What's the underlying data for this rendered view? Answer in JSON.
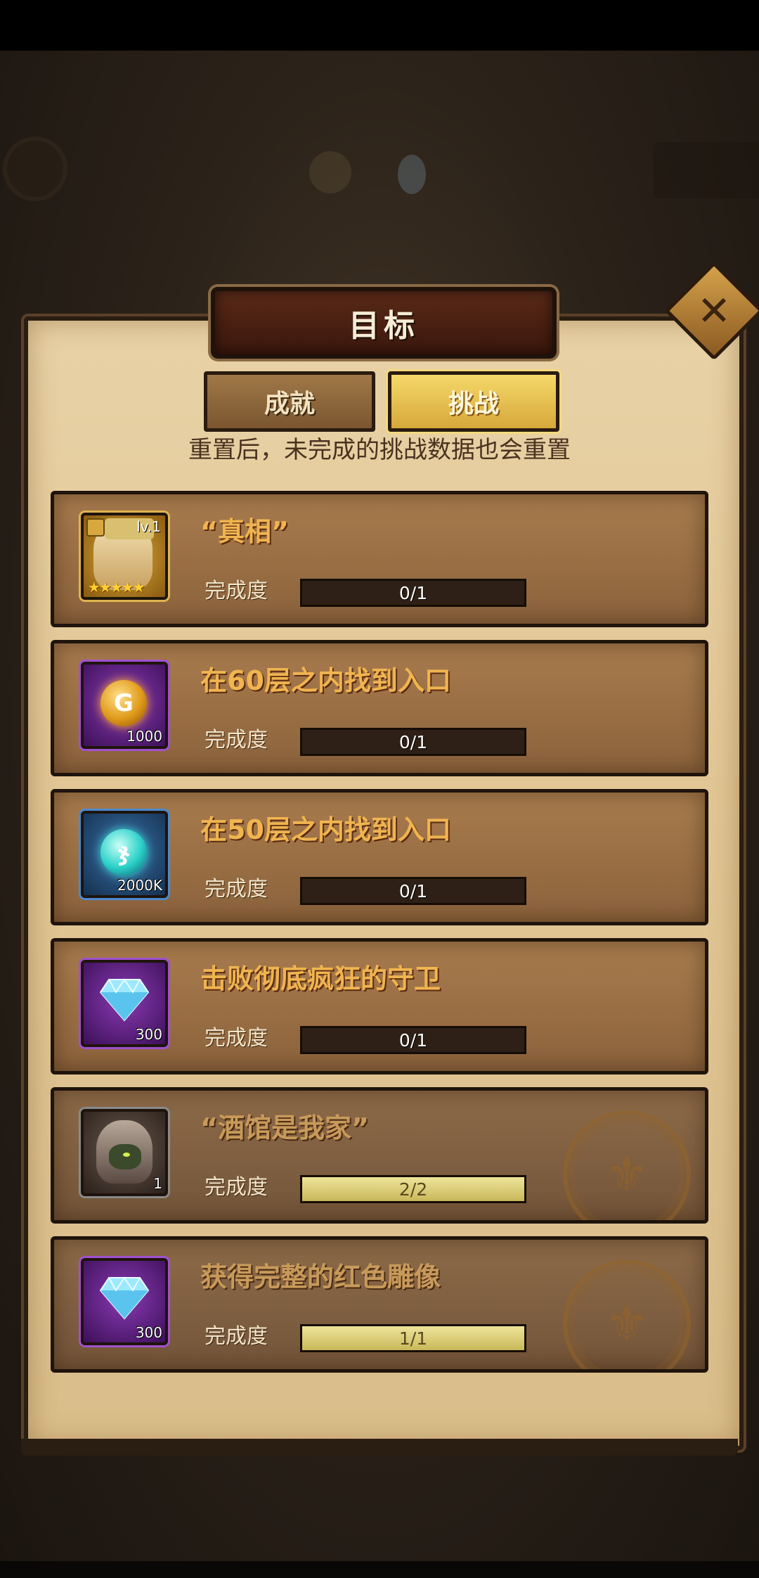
{
  "dialog": {
    "title": "目标",
    "close_glyph": "✕",
    "tabs": [
      {
        "label": "成就",
        "active": false
      },
      {
        "label": "挑战",
        "active": true
      }
    ],
    "notice": "重置后，未完成的挑战数据也会重置"
  },
  "progress_label": "完成度",
  "challenges": [
    {
      "title": "“真相”",
      "progress_text": "0/1",
      "progress": 0,
      "reward": {
        "icon": "hero-portrait-icon",
        "level": "lv.1",
        "stars": "★★★★★",
        "frame": "gold"
      },
      "completed": false
    },
    {
      "title": "在60层之内找到入口",
      "progress_text": "0/1",
      "progress": 0,
      "reward": {
        "icon": "gold-coin-icon",
        "count": "1000",
        "frame": "purple"
      },
      "completed": false
    },
    {
      "title": "在50层之内找到入口",
      "progress_text": "0/1",
      "progress": 0,
      "reward": {
        "icon": "teal-coin-icon",
        "count": "2000K",
        "frame": "blue"
      },
      "completed": false
    },
    {
      "title": "击败彻底疯狂的守卫",
      "progress_text": "0/1",
      "progress": 0,
      "reward": {
        "icon": "diamond-icon",
        "count": "300",
        "frame": "purple"
      },
      "completed": false
    },
    {
      "title": "“酒馆是我家”",
      "progress_text": "2/2",
      "progress": 1,
      "reward": {
        "icon": "hooded-hero-icon",
        "count": "1",
        "frame": "gray"
      },
      "completed": true
    },
    {
      "title": "获得完整的红色雕像",
      "progress_text": "1/1",
      "progress": 1,
      "reward": {
        "icon": "diamond-icon",
        "count": "300",
        "frame": "purple"
      },
      "completed": true
    }
  ],
  "colors": {
    "accent_gold": "#f0b450",
    "panel": "#e2c796",
    "title_plate": "#4a2010"
  }
}
